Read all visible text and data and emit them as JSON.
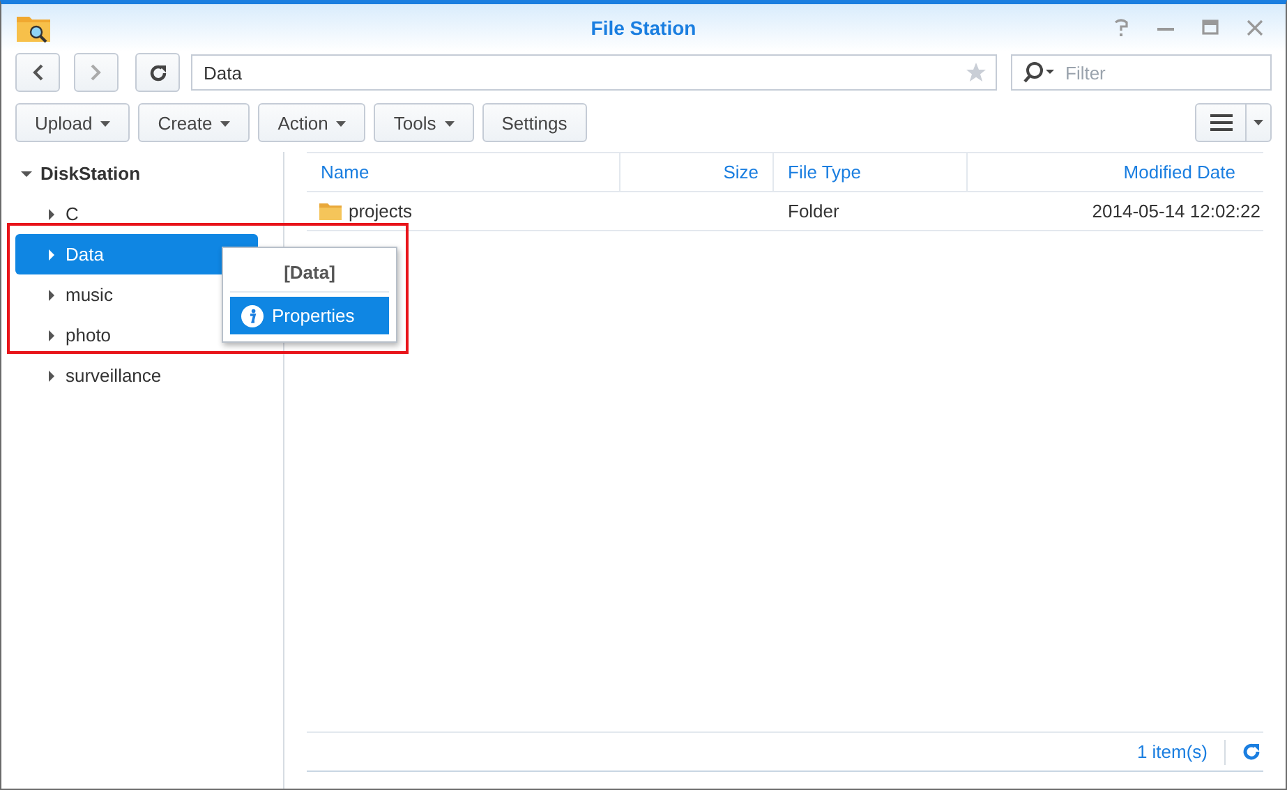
{
  "window": {
    "title": "File Station"
  },
  "path_field": {
    "value": "Data"
  },
  "filter_field": {
    "placeholder": "Filter"
  },
  "toolbar": [
    {
      "label": "Upload",
      "dropdown": true
    },
    {
      "label": "Create",
      "dropdown": true
    },
    {
      "label": "Action",
      "dropdown": true
    },
    {
      "label": "Tools",
      "dropdown": true
    },
    {
      "label": "Settings",
      "dropdown": false
    }
  ],
  "tree": [
    {
      "label": "DiskStation",
      "expanded": true,
      "selected": false,
      "children": [
        {
          "label": "C",
          "expanded": false,
          "selected": false
        },
        {
          "label": "Data",
          "expanded": false,
          "selected": true
        },
        {
          "label": "music",
          "expanded": false,
          "selected": false
        },
        {
          "label": "photo",
          "expanded": false,
          "selected": false
        },
        {
          "label": "surveillance",
          "expanded": false,
          "selected": false
        }
      ]
    }
  ],
  "context_menu": {
    "title": "[Data]",
    "items": [
      {
        "label": "Properties",
        "selected": true
      }
    ]
  },
  "table": {
    "columns": [
      {
        "label": "Name"
      },
      {
        "label": "Size"
      },
      {
        "label": "File Type"
      },
      {
        "label": "Modified Date"
      }
    ],
    "rows": [
      {
        "name": "projects",
        "type": "Folder",
        "modified": "2014-05-14 12:02:22"
      }
    ]
  },
  "status_bar": {
    "count": "1 item(s)"
  }
}
